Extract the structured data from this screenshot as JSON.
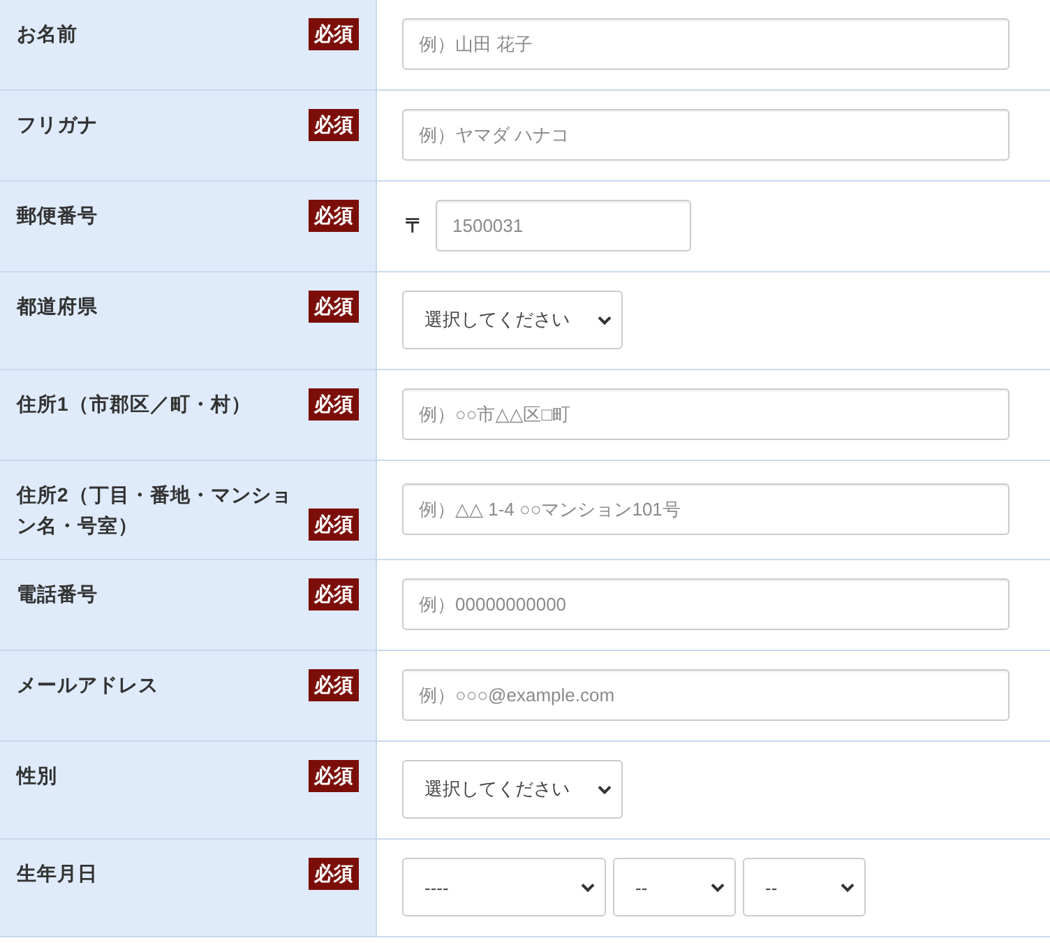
{
  "form": {
    "rows": [
      {
        "label": "お名前",
        "badge": "必須",
        "field": {
          "kind": "text",
          "placeholder": "例）山田 花子"
        }
      },
      {
        "label": "フリガナ",
        "badge": "必須",
        "field": {
          "kind": "text",
          "placeholder": "例）ヤマダ ハナコ"
        }
      },
      {
        "label": "郵便番号",
        "badge": "必須",
        "field": {
          "kind": "postal",
          "prefix": "〒",
          "placeholder": "1500031"
        }
      },
      {
        "label": "都道府県",
        "badge": "必須",
        "field": {
          "kind": "select",
          "selects": [
            "選択してください"
          ]
        }
      },
      {
        "label": "住所1（市郡区／町・村）",
        "badge": "必須",
        "field": {
          "kind": "text",
          "placeholder": "例）○○市△△区□町"
        }
      },
      {
        "label": "住所2（丁目・番地・マンション名・号室）",
        "badge": "必須",
        "field": {
          "kind": "text",
          "placeholder": "例）△△ 1-4 ○○マンション101号"
        }
      },
      {
        "label": "電話番号",
        "badge": "必須",
        "field": {
          "kind": "text",
          "placeholder": "例）00000000000"
        }
      },
      {
        "label": "メールアドレス",
        "badge": "必須",
        "field": {
          "kind": "text",
          "placeholder": "例）○○○@example.com"
        }
      },
      {
        "label": "性別",
        "badge": "必須",
        "field": {
          "kind": "select",
          "selects": [
            "選択してください"
          ]
        }
      },
      {
        "label": "生年月日",
        "badge": "必須",
        "field": {
          "kind": "select",
          "selects": [
            "----",
            "--",
            "--"
          ]
        }
      }
    ]
  }
}
